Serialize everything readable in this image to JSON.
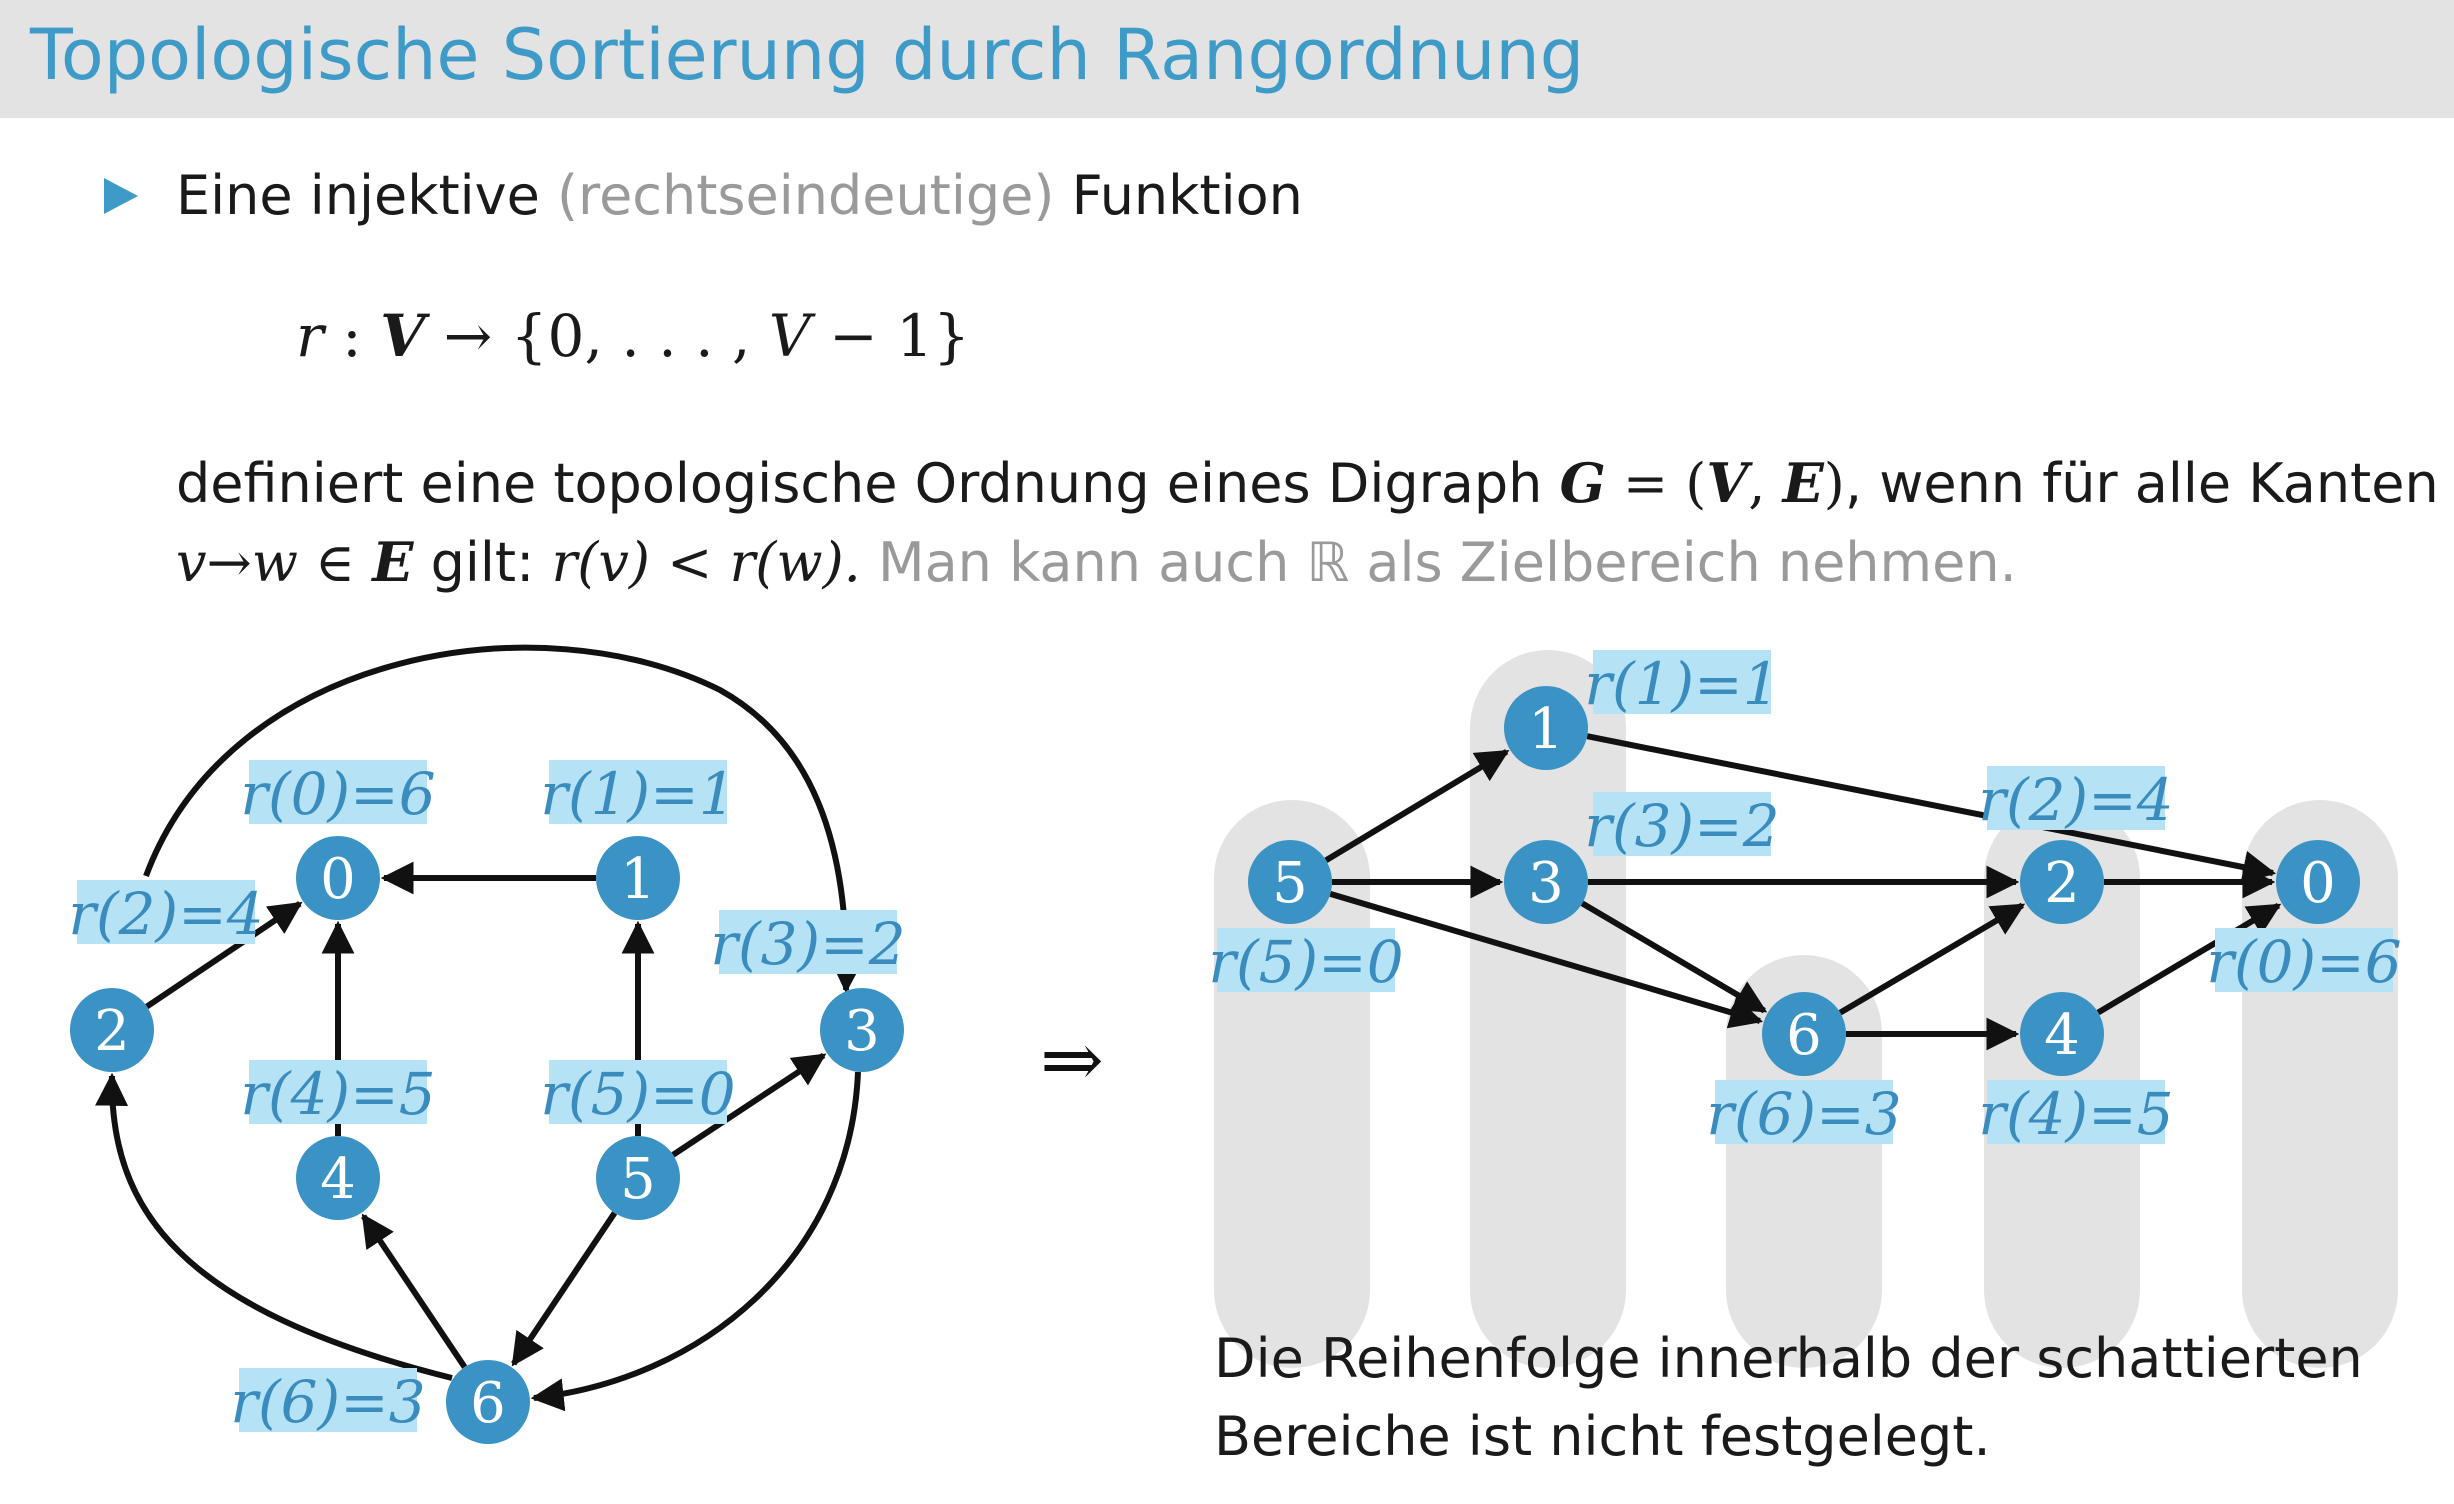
{
  "slide": {
    "title": "Topologische Sortierung durch Rangordnung",
    "bullet_prefix": "Eine injektive ",
    "bullet_paren": "(rechtseindeutige)",
    "bullet_suffix": " Funktion",
    "formula": {
      "r": "r",
      "colon": " : ",
      "V": "V",
      "arrow": " → ",
      "set_open": "{0, . . . , ",
      "V2": "V",
      "set_close": " − 1}"
    },
    "para": {
      "p1": "definiert eine topologische Ordnung eines Digraph ",
      "G": "G",
      "eq": " = (",
      "V": "V",
      "comma": ", ",
      "E": "E",
      "close": ")",
      "p2": ", wenn für alle Kanten",
      "vw": "v→w",
      "in": " ∈ ",
      "E2": "E",
      "gilt": " gilt: ",
      "cond": "r(v) < r(w).",
      "gray": " Man kann auch ℝ als Zielbereich nehmen."
    },
    "implies": "⇒",
    "note_line1": "Die Reihenfolge innerhalb der schattierten",
    "note_line2": "Bereiche ist nicht festgelegt."
  },
  "colors": {
    "title": "#3e9ac6",
    "node_fill": "#3a92c5",
    "label_bg": "#b5e3f5",
    "label_text": "#3a8cbf",
    "shade": "#e3e3e3",
    "edge": "#111111"
  },
  "graph_left": {
    "nodes": [
      {
        "id": "0",
        "label": "r(0)=6"
      },
      {
        "id": "1",
        "label": "r(1)=1"
      },
      {
        "id": "2",
        "label": "r(2)=4"
      },
      {
        "id": "3",
        "label": "r(3)=2"
      },
      {
        "id": "4",
        "label": "r(4)=5"
      },
      {
        "id": "5",
        "label": "r(5)=0"
      },
      {
        "id": "6",
        "label": "r(6)=3"
      }
    ],
    "edges": [
      [
        "1",
        "0"
      ],
      [
        "2",
        "0"
      ],
      [
        "4",
        "0"
      ],
      [
        "5",
        "1"
      ],
      [
        "5",
        "3"
      ],
      [
        "5",
        "6"
      ],
      [
        "6",
        "4"
      ],
      [
        "6",
        "2"
      ],
      [
        "3",
        "6"
      ],
      [
        "2",
        "3"
      ]
    ]
  },
  "graph_right": {
    "nodes": [
      {
        "id": "5",
        "label": "r(5)=0"
      },
      {
        "id": "1",
        "label": "r(1)=1"
      },
      {
        "id": "3",
        "label": "r(3)=2"
      },
      {
        "id": "6",
        "label": "r(6)=3"
      },
      {
        "id": "2",
        "label": "r(2)=4"
      },
      {
        "id": "4",
        "label": "r(4)=5"
      },
      {
        "id": "0",
        "label": "r(0)=6"
      }
    ],
    "edges": [
      [
        "5",
        "1"
      ],
      [
        "5",
        "3"
      ],
      [
        "5",
        "6"
      ],
      [
        "1",
        "0"
      ],
      [
        "3",
        "2"
      ],
      [
        "3",
        "6"
      ],
      [
        "6",
        "2"
      ],
      [
        "6",
        "4"
      ],
      [
        "2",
        "0"
      ],
      [
        "4",
        "0"
      ]
    ]
  }
}
